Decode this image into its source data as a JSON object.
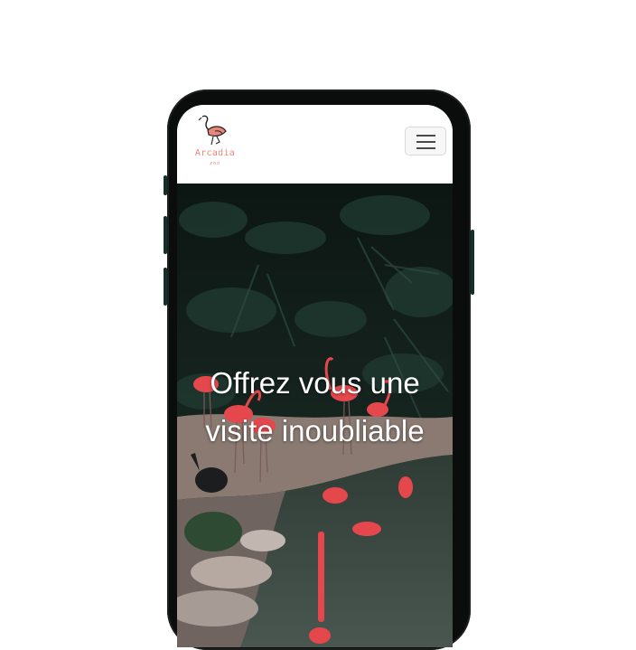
{
  "brand": {
    "name": "Arcadia",
    "subtitle": "zoo",
    "accent": "#e7877a"
  },
  "navbar": {
    "menu_icon": "hamburger-icon"
  },
  "hero": {
    "title": "Offrez vous une visite inoubliable",
    "background": "flamingos-by-pond-photo"
  },
  "colors": {
    "phone_frame": "#0b0d0c",
    "flamingo": "#e5484c",
    "water": "#3d4a44"
  }
}
